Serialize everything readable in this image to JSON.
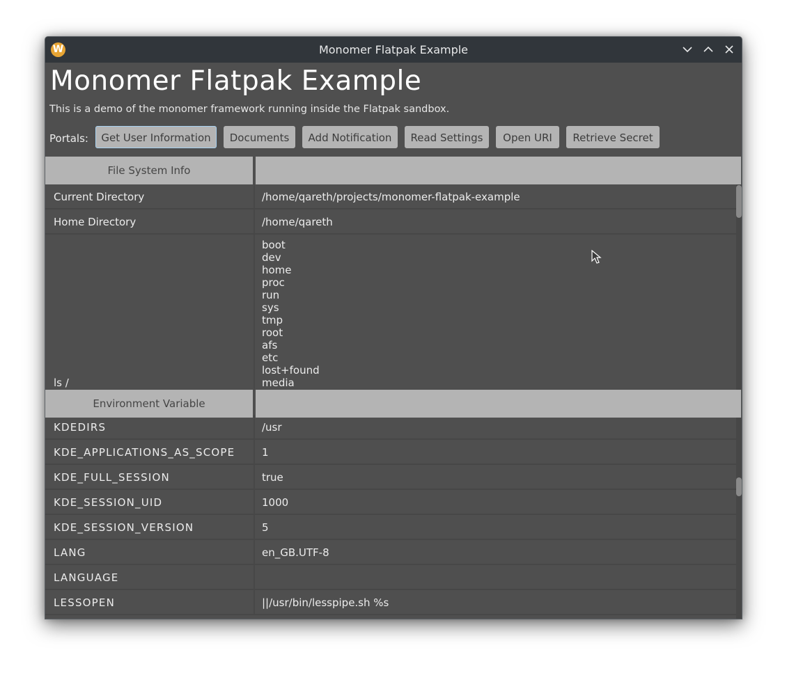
{
  "window": {
    "title": "Monomer Flatpak Example",
    "app_icon_glyph": "W",
    "controls": [
      "minimize",
      "maximize",
      "close"
    ]
  },
  "header": {
    "heading": "Monomer Flatpak Example",
    "description": "This is a demo of the monomer framework running inside the Flatpak sandbox."
  },
  "portals": {
    "label": "Portals:",
    "buttons": [
      {
        "label": "Get User Information",
        "focused": true
      },
      {
        "label": "Documents"
      },
      {
        "label": "Add Notification"
      },
      {
        "label": "Read Settings"
      },
      {
        "label": "Open URI"
      },
      {
        "label": "Retrieve Secret"
      }
    ]
  },
  "file_system": {
    "header": "File System Info",
    "header_value": "",
    "rows": [
      {
        "key": "Current Directory",
        "value": "/home/qareth/projects/monomer-flatpak-example"
      },
      {
        "key": "Home Directory",
        "value": "/home/qareth"
      }
    ],
    "ls": {
      "key": "ls /",
      "entries": [
        "boot",
        "dev",
        "home",
        "proc",
        "run",
        "sys",
        "tmp",
        "root",
        "afs",
        "etc",
        "lost+found",
        "media"
      ]
    }
  },
  "environment": {
    "header": "Environment Variable",
    "header_value": "",
    "rows": [
      {
        "key": "KDEDIRS",
        "value": "/usr"
      },
      {
        "key": "KDE_APPLICATIONS_AS_SCOPE",
        "value": "1"
      },
      {
        "key": "KDE_FULL_SESSION",
        "value": "true"
      },
      {
        "key": "KDE_SESSION_UID",
        "value": "1000"
      },
      {
        "key": "KDE_SESSION_VERSION",
        "value": "5"
      },
      {
        "key": "LANG",
        "value": "en_GB.UTF-8"
      },
      {
        "key": "LANGUAGE",
        "value": ""
      },
      {
        "key": "LESSOPEN",
        "value": "||/usr/bin/lesspipe.sh %s"
      }
    ]
  },
  "colors": {
    "titlebar": "#31363b",
    "background": "#4f4f4f",
    "button": "#b4b4b4",
    "focus_border": "#a7d1f0",
    "app_icon": "#e8a534"
  }
}
